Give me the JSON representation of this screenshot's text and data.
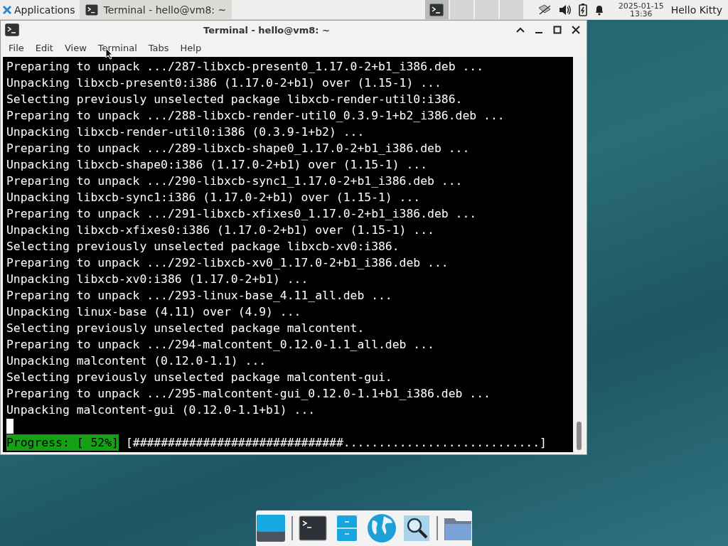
{
  "panel": {
    "applications": "Applications",
    "tasks": [
      {
        "title": "Terminal - hello@vm8: ~",
        "selected": true
      }
    ],
    "workspaces": [
      {
        "selected": true
      },
      {
        "selected": false
      },
      {
        "selected": false
      },
      {
        "selected": false
      }
    ],
    "clock": {
      "date": "2025-01-15",
      "time": "13:36"
    },
    "user": "Hello Kitty"
  },
  "window": {
    "title": "Terminal - hello@vm8: ~",
    "menu": [
      "File",
      "Edit",
      "View",
      "Terminal",
      "Tabs",
      "Help"
    ],
    "lines": [
      "Preparing to unpack .../287-libxcb-present0_1.17.0-2+b1_i386.deb ...",
      "Unpacking libxcb-present0:i386 (1.17.0-2+b1) over (1.15-1) ...",
      "Selecting previously unselected package libxcb-render-util0:i386.",
      "Preparing to unpack .../288-libxcb-render-util0_0.3.9-1+b2_i386.deb ...",
      "Unpacking libxcb-render-util0:i386 (0.3.9-1+b2) ...",
      "Preparing to unpack .../289-libxcb-shape0_1.17.0-2+b1_i386.deb ...",
      "Unpacking libxcb-shape0:i386 (1.17.0-2+b1) over (1.15-1) ...",
      "Preparing to unpack .../290-libxcb-sync1_1.17.0-2+b1_i386.deb ...",
      "Unpacking libxcb-sync1:i386 (1.17.0-2+b1) over (1.15-1) ...",
      "Preparing to unpack .../291-libxcb-xfixes0_1.17.0-2+b1_i386.deb ...",
      "Unpacking libxcb-xfixes0:i386 (1.17.0-2+b1) over (1.15-1) ...",
      "Selecting previously unselected package libxcb-xv0:i386.",
      "Preparing to unpack .../292-libxcb-xv0_1.17.0-2+b1_i386.deb ...",
      "Unpacking libxcb-xv0:i386 (1.17.0-2+b1) ...",
      "Preparing to unpack .../293-linux-base_4.11_all.deb ...",
      "Unpacking linux-base (4.11) over (4.9) ...",
      "Selecting previously unselected package malcontent.",
      "Preparing to unpack .../294-malcontent_0.12.0-1.1_all.deb ...",
      "Unpacking malcontent (0.12.0-1.1) ...",
      "Selecting previously unselected package malcontent-gui.",
      "Preparing to unpack .../295-malcontent-gui_0.12.0-1.1+b1_i386.deb ...",
      "Unpacking malcontent-gui (0.12.0-1.1+b1) ..."
    ],
    "progress": {
      "label": "Progress: [ 52%]",
      "bar": "[##############################............................]"
    }
  },
  "dock": [
    {
      "kind": "desktop"
    },
    {
      "kind": "terminal"
    },
    {
      "kind": "files-cabinet"
    },
    {
      "kind": "browser"
    },
    {
      "kind": "search"
    },
    {
      "kind": "folder"
    }
  ]
}
